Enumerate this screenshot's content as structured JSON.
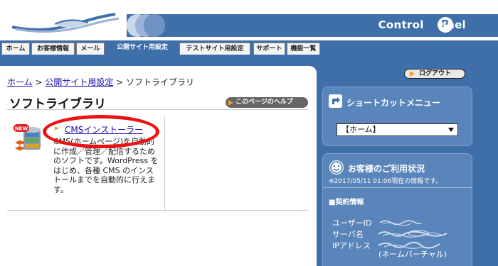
{
  "header": {
    "title": "Control",
    "title_p": "P",
    "title_suffix": "anel",
    "brand_color": "#3f6fa8"
  },
  "tabs": [
    {
      "label": "ホーム",
      "active": false
    },
    {
      "label": "お客様情報",
      "active": false
    },
    {
      "label": "メール",
      "active": false
    },
    {
      "label": "公開サイト用設定",
      "active": true
    },
    {
      "label": "テストサイト用設定",
      "active": false
    },
    {
      "label": "サポート",
      "active": false
    },
    {
      "label": "機能一覧",
      "active": false
    }
  ],
  "breadcrumb": {
    "home": "ホーム",
    "sep1": " > ",
    "public_site": "公開サイト用設定",
    "sep2": " > ",
    "current": "ソフトライブラリ"
  },
  "main": {
    "title": "ソフトライブラリ",
    "help_label": "このページのヘルプ",
    "app": {
      "badge": "NEW",
      "name": "CMSインストーラー",
      "description": "CMS(ホームページ)を自動的に作成／管理／配信するためのソフトです。WordPress をはじめ、各種 CMS のインストールまでを自動的に行えます。"
    }
  },
  "sidebar": {
    "logout_label": "ログアウト",
    "shortcut": {
      "title": "ショートカットメニュー",
      "selected": "【ホーム】"
    },
    "status": {
      "title": "お客様のご利用状況",
      "timestamp": "※2017/05/11 01:06現在の情報です。"
    },
    "contract": {
      "title": "■契約情報",
      "user_id_label": "ユーザーID",
      "server_label": "サーバ名",
      "ip_label": "IPアドレス",
      "vhost_note": "(ネームバーチャル)"
    }
  }
}
